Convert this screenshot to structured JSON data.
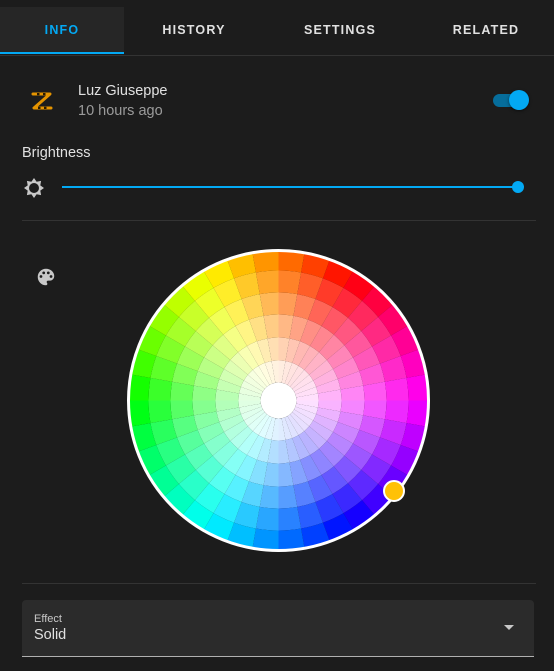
{
  "tabs": [
    {
      "label": "INFO",
      "active": true
    },
    {
      "label": "HISTORY",
      "active": false
    },
    {
      "label": "SETTINGS",
      "active": false
    },
    {
      "label": "RELATED",
      "active": false
    }
  ],
  "entity": {
    "name": "Luz Giuseppe",
    "last_changed": "10 hours ago",
    "icon": "lightstrip-icon",
    "on": true
  },
  "brightness": {
    "label": "Brightness",
    "icon": "brightness-icon",
    "value_percent": 100
  },
  "color": {
    "icon": "palette-icon",
    "selected_color": "#ffc107"
  },
  "effect": {
    "label": "Effect",
    "value": "Solid"
  },
  "colors": {
    "accent": "#03a9f4",
    "background": "#1c1c1c"
  }
}
